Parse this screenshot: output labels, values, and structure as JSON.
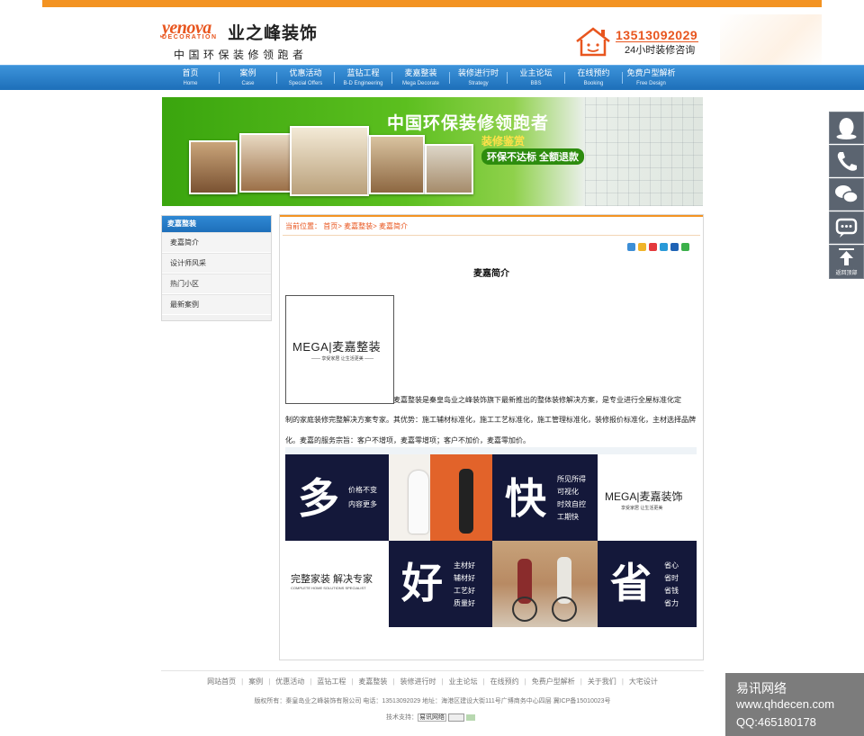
{
  "header": {
    "logo_en": "yenova",
    "logo_en_sub": "DECORATION",
    "logo_cn": "业之峰装饰",
    "slogan": "中国环保装修领跑者",
    "phone": "13513092029",
    "hotline_text": "24小时装修咨询"
  },
  "nav": [
    {
      "cn": "首页",
      "en": "Home"
    },
    {
      "cn": "案例",
      "en": "Case"
    },
    {
      "cn": "优惠活动",
      "en": "Special Offers"
    },
    {
      "cn": "蓝钻工程",
      "en": "B-D Engineering"
    },
    {
      "cn": "麦嘉整装",
      "en": "Mega Decorate"
    },
    {
      "cn": "装修进行时",
      "en": "Strategy"
    },
    {
      "cn": "业主论坛",
      "en": "BBS"
    },
    {
      "cn": "在线预约",
      "en": "Booking"
    },
    {
      "cn": "免费户型解析",
      "en": "Free Design"
    }
  ],
  "banner": {
    "title": "中国环保装修领跑者",
    "sub1": "装修鉴赏",
    "sub2": "环保不达标 全额退款"
  },
  "sidebar": {
    "title": "麦嘉整装",
    "items": [
      "麦嘉简介",
      "设计师风采",
      "热门小区",
      "最新案例"
    ]
  },
  "main": {
    "breadcrumb": "当前位置： 首页> 麦嘉整装> 麦嘉简介",
    "title": "麦嘉简介",
    "logo_text": "MEGA|麦嘉整装",
    "logo_tag": "—— 享受家居 让生活更美 ——",
    "intro_first": "麦嘉整装是秦皇岛业之峰装饰旗下最新推出的整体装修解决方案，是专业进行全屋标准化定",
    "intro_rest": "制的家庭装修完整解决方案专家。其优势：施工辅材标准化，施工工艺标准化，施工管理标准化，装修报价标准化，主材选择品牌化。麦嘉的服务宗旨：客户不增项，麦嘉零增项；客户不加价，麦嘉零加价。",
    "grid": {
      "c1_big": "多",
      "c1_lines": [
        "价格不变",
        "内容更多"
      ],
      "c3_big": "快",
      "c3_lines": [
        "所见所得",
        "可视化",
        "时效自控",
        "工期快"
      ],
      "c4_logo": "MEGA|麦嘉装饰",
      "c4_tag": "享受家居 让生活更美",
      "c5_line1": "完整家装 解决专家",
      "c5_line2": "COMPLETE HOME SOLUTIONS SPECIALIST",
      "c6_big": "好",
      "c6_lines": [
        "主材好",
        "辅材好",
        "工艺好",
        "质量好"
      ],
      "c8_big": "省",
      "c8_lines": [
        "省心",
        "省时",
        "省钱",
        "省力"
      ]
    }
  },
  "footer": {
    "links": [
      "网站首页",
      "案例",
      "优惠活动",
      "蓝钻工程",
      "麦嘉整装",
      "装修进行时",
      "业主论坛",
      "在线预约",
      "免费户型解析",
      "关于我们",
      "大宅设计"
    ],
    "copyright": "版权所有：秦皇岛业之峰装饰有限公司 电话：13513092029 地址：海港区建设大街111号广博商务中心四层 冀ICP备15010023号",
    "support": "技术支持：",
    "support_name": "易讯网络"
  },
  "float_bar": {
    "top_label": "返回顶部"
  },
  "watermark": {
    "line1": "易讯网络",
    "line2": "www.qhdecen.com",
    "line3": "QQ:465180178"
  },
  "colors": {
    "orange": "#f39322",
    "nav_blue": "#1d6fb9",
    "navy": "#14183a"
  }
}
